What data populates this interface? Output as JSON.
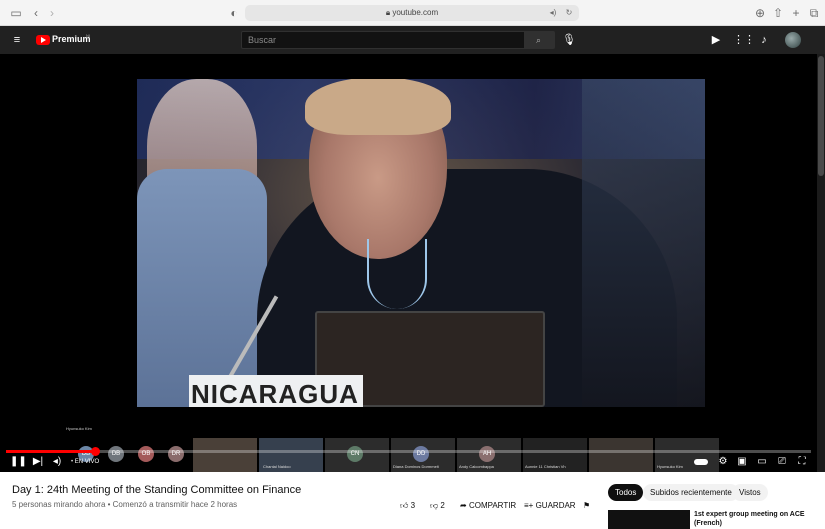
{
  "browser": {
    "url": "youtube.com"
  },
  "header": {
    "logo_text": "Premium",
    "logo_badge": "NI",
    "search_placeholder": "Buscar"
  },
  "video": {
    "banner_text": "NICARAGUA",
    "participant_label": "Hyunsuko Kim",
    "live_label": "EN VIVO",
    "participants": [
      "DB",
      "OB",
      "DR",
      "CN",
      "DD",
      "AH"
    ],
    "tile_captions": [
      "Chantal Naidoo",
      "Diana Dominos Dormmelt",
      "Andy Calcombappa",
      "Aunnie 11 Christian Vh",
      "Hyunsuko Kim"
    ],
    "progress_fraction": 0.11
  },
  "details": {
    "title": "Day 1: 24th Meeting of the Standing Committee on Finance",
    "meta": "5 personas mirando ahora • Comenzó a transmitir hace 2 horas",
    "likes": "3",
    "dislikes": "2",
    "share_label": "COMPARTIR",
    "save_label": "GUARDAR"
  },
  "chips": [
    "Todos",
    "Subidos recientemente",
    "Vistos"
  ],
  "recommendation": {
    "title": "1st expert group meeting on ACE (French)"
  },
  "colors": {
    "accent": "#ff0000",
    "header_bg": "#212121"
  }
}
